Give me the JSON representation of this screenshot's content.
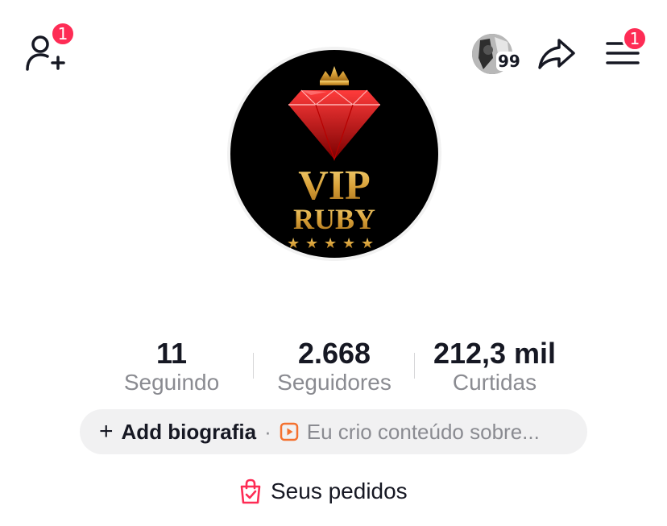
{
  "header": {
    "add_friend_badge": "1",
    "story_count": "99",
    "menu_badge": "1"
  },
  "avatar": {
    "logo_line1": "VIP",
    "logo_line2": "RUBY"
  },
  "stats": [
    {
      "value": "11",
      "label": "Seguindo"
    },
    {
      "value": "2.668",
      "label": "Seguidores"
    },
    {
      "value": "212,3 mil",
      "label": "Curtidas"
    }
  ],
  "bio": {
    "add_label": "Add biografia",
    "separator": "·",
    "suggestion": "Eu crio conteúdo sobre..."
  },
  "orders": {
    "label": "Seus pedidos"
  },
  "colors": {
    "badge": "#fe2c55",
    "text_primary": "#161823",
    "text_secondary": "#8a8b91",
    "pill_bg": "#f1f1f2",
    "play_icon": "#f4712f"
  },
  "icons": [
    "add-friend-icon",
    "share-icon",
    "menu-icon",
    "play-icon",
    "shopping-bag-icon"
  ]
}
